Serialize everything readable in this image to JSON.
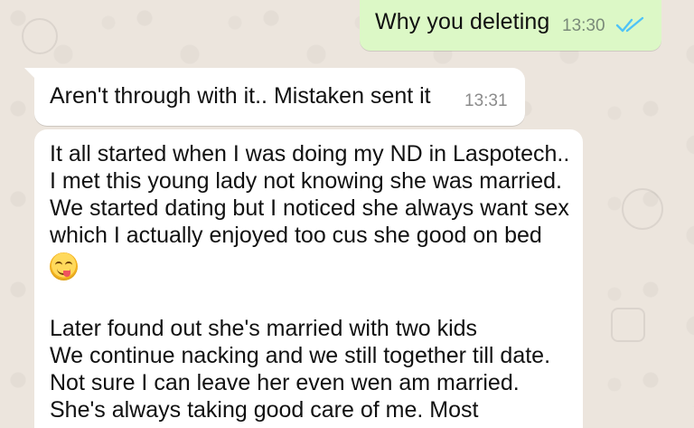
{
  "messages": {
    "outgoing": {
      "text": "Why you deleting",
      "time": "13:30",
      "status_icon": "double-check-icon"
    },
    "incoming_short": {
      "text": "Aren't through with it..  Mistaken sent it",
      "time": "13:31"
    },
    "incoming_long": {
      "lines": [
        "It all started when I was doing my ND in Laspotech..",
        "I met this young lady not knowing she was married.",
        "We started dating but I noticed she always want sex",
        "which I actually enjoyed too cus she good on bed",
        "",
        "Later found out she's married with two kids",
        "We continue nacking and we still together till date.",
        "Not sure I can leave her even wen am married.",
        "She's always taking good care of me. Most"
      ],
      "emoji": "face-savoring-food-emoji"
    }
  },
  "colors": {
    "outgoing_bubble": "#dcf8c6",
    "incoming_bubble": "#ffffff",
    "background": "#ece5dd",
    "read_ticks": "#4fc3f7"
  }
}
